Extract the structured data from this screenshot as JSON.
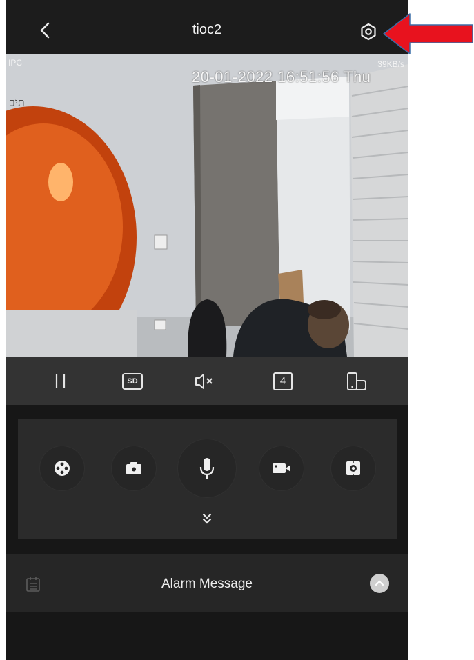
{
  "header": {
    "title": "tioc2",
    "back_icon": "chevron-left-icon",
    "settings_icon": "gear-icon"
  },
  "video": {
    "channel_label": "IPC",
    "bitrate": "39KB/s",
    "timestamp": "20-01-2022 16:51:56 Thu",
    "camera_name": "תיב"
  },
  "controls": [
    {
      "name": "pause-icon"
    },
    {
      "name": "sd-quality-icon",
      "text": "SD"
    },
    {
      "name": "mute-icon"
    },
    {
      "name": "split-screen-icon",
      "text": "4"
    },
    {
      "name": "rotate-fullscreen-icon"
    }
  ],
  "actions": [
    {
      "name": "ptz-icon"
    },
    {
      "name": "snapshot-icon"
    },
    {
      "name": "microphone-icon"
    },
    {
      "name": "record-icon"
    },
    {
      "name": "capture-icon"
    }
  ],
  "alarm": {
    "label": "Alarm Message"
  },
  "colors": {
    "annotation_arrow": "#e8121e",
    "accent_border": "#3a6ea8"
  }
}
